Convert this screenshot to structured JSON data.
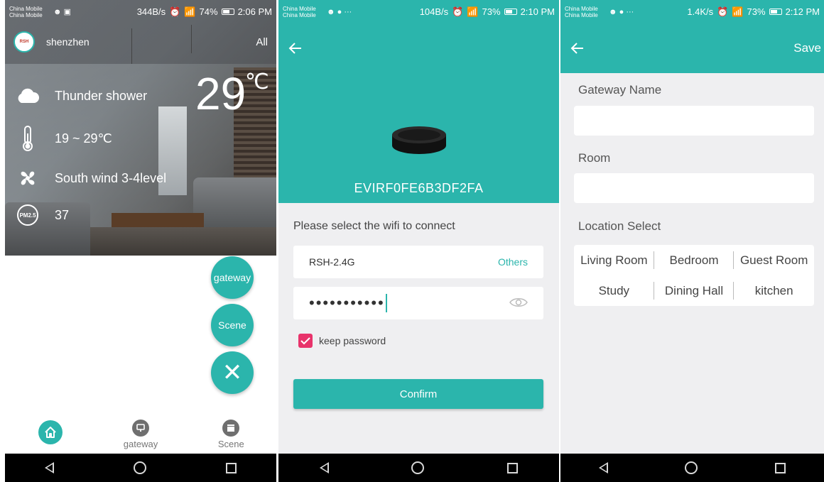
{
  "screens": [
    {
      "status": {
        "carrier_1": "China Mobile",
        "carrier_2": "China Mobile",
        "speed": "344B/s",
        "battery": "74%",
        "time": "2:06 PM",
        "battery_level": 0.74
      },
      "city": {
        "name": "shenzhen",
        "filter": "All",
        "logo_text": "RSH"
      },
      "weather": {
        "condition": "Thunder shower",
        "temp_range": "19 ~ 29℃",
        "wind": "South wind 3-4level",
        "pm_label": "PM2.5",
        "pm_value": "37",
        "temperature": "29",
        "temp_unit": "℃"
      },
      "fabs": {
        "gateway": "gateway",
        "scene": "Scene",
        "close": "✕"
      },
      "tabs": [
        {
          "label": ""
        },
        {
          "label": "gateway"
        },
        {
          "label": "Scene"
        }
      ]
    },
    {
      "status": {
        "carrier_1": "China Mobile",
        "carrier_2": "China Mobile",
        "speed": "104B/s",
        "battery": "73%",
        "time": "2:10 PM",
        "battery_level": 0.73
      },
      "device_id": "EVIRF0FE6B3DF2FA",
      "prompt": "Please select the wifi to connect",
      "ssid": "RSH-2.4G",
      "others_label": "Others",
      "password_mask": "•••••••••••",
      "keep_password_label": "keep password",
      "confirm_label": "Confirm"
    },
    {
      "status": {
        "carrier_1": "China Mobile",
        "carrier_2": "China Mobile",
        "speed": "1.4K/s",
        "battery": "73%",
        "time": "2:12 PM",
        "battery_level": 0.73
      },
      "save_label": "Save",
      "gateway_name_label": "Gateway Name",
      "gateway_name_value": "",
      "room_label": "Room",
      "room_value": "",
      "location_label": "Location Select",
      "locations": [
        "Living Room",
        "Bedroom",
        "Guest Room",
        "Study",
        "Dining Hall",
        "kitchen"
      ]
    }
  ],
  "colors": {
    "accent": "#2bb5ac",
    "checkbox": "#e8336b",
    "background": "#efeff1"
  }
}
